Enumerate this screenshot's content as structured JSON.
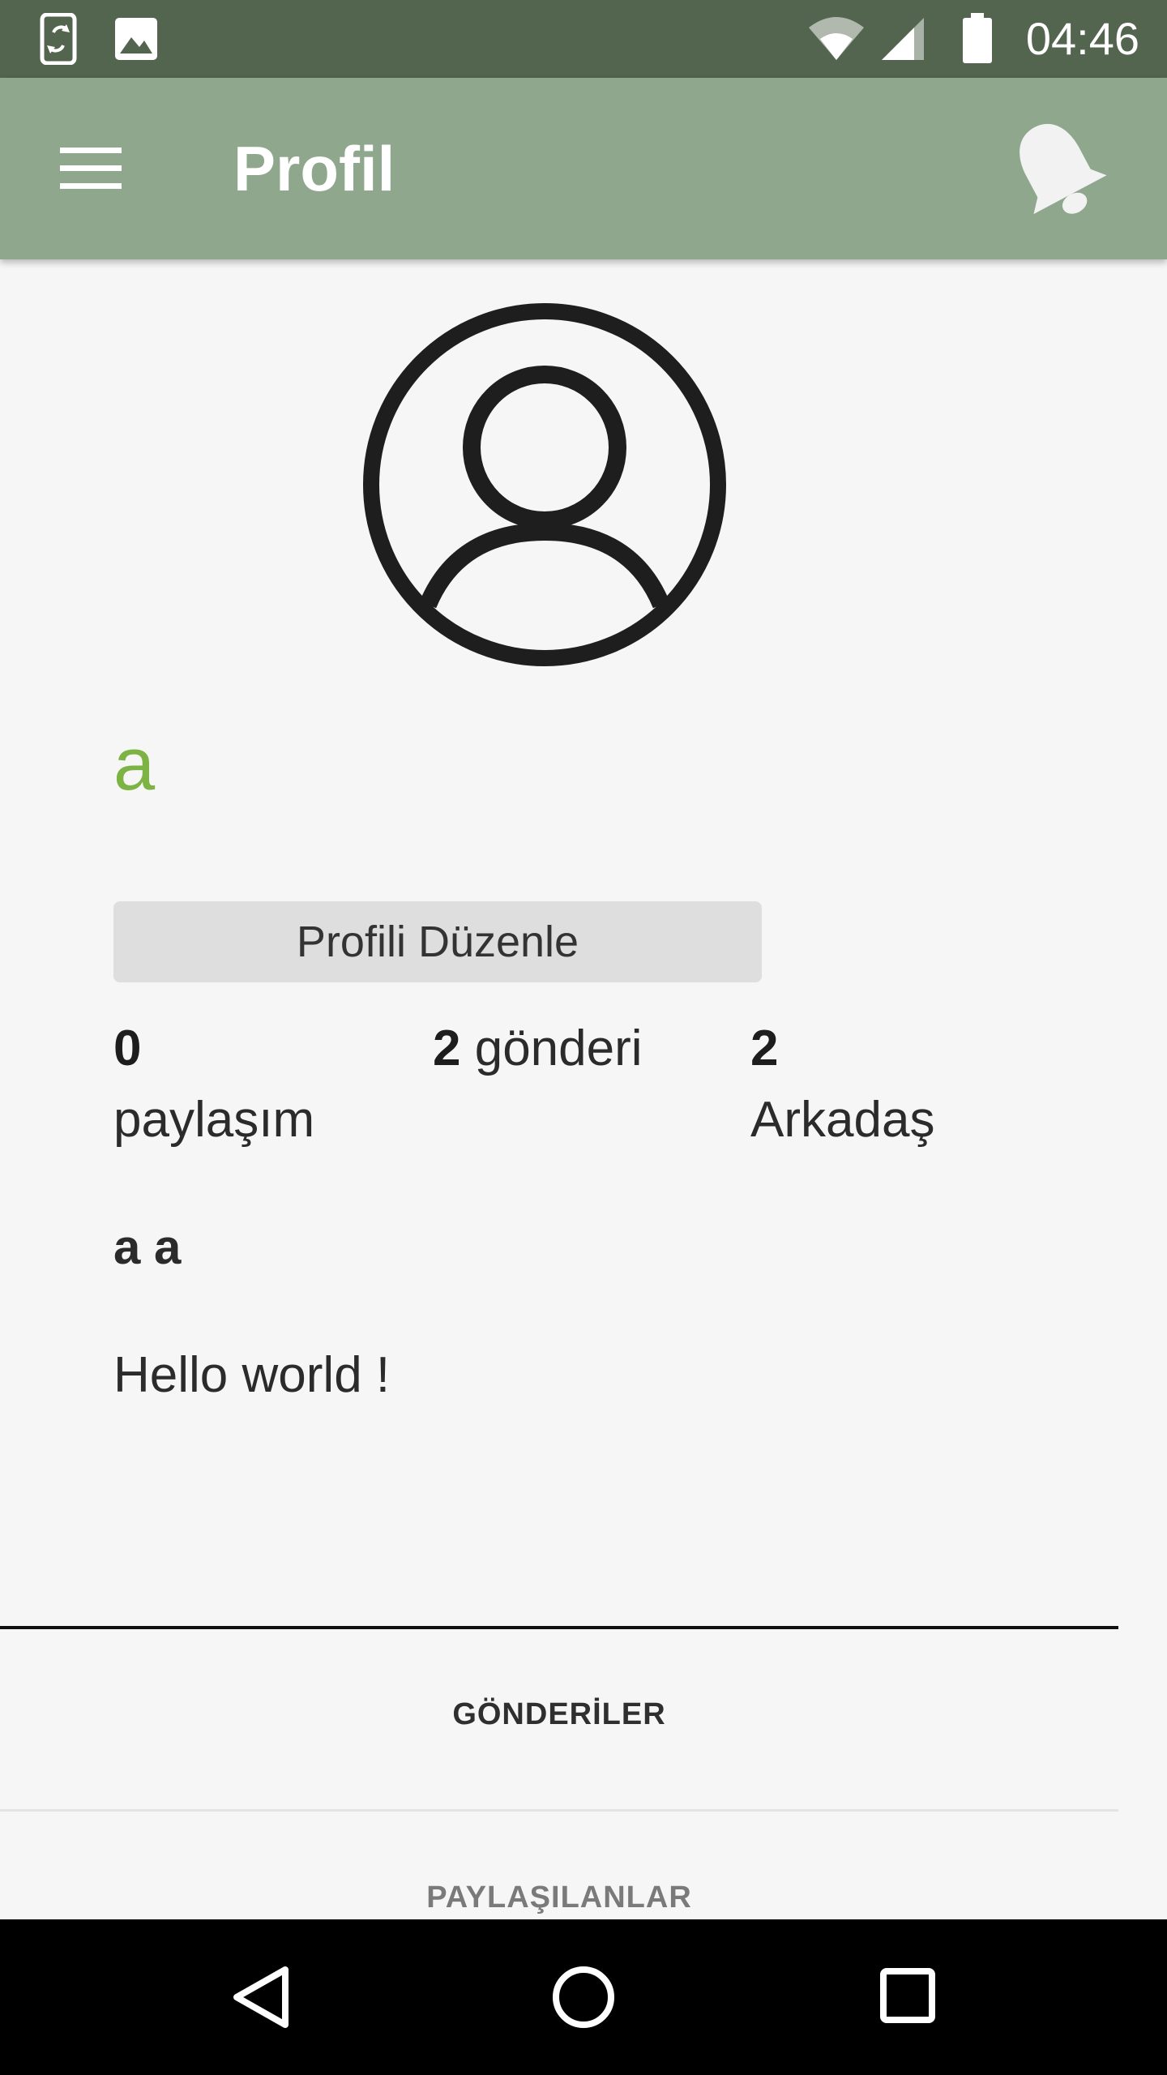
{
  "status_bar": {
    "time": "04:46",
    "icons": [
      "sync-phone-icon",
      "image-icon",
      "wifi-icon",
      "signal-icon",
      "battery-icon"
    ]
  },
  "app_bar": {
    "title": "Profil",
    "menu_icon": "hamburger-menu-icon",
    "notification_icon": "bell-icon"
  },
  "profile": {
    "avatar_icon": "account-circle-icon",
    "username": "a",
    "edit_button_label": "Profili Düzenle",
    "stats": {
      "shares": {
        "count": "0",
        "label": "paylaşım"
      },
      "posts": {
        "count": "2",
        "label": "gönderi"
      },
      "friends": {
        "count": "2",
        "label": "Arkadaş"
      }
    },
    "full_name": "a a",
    "bio": "Hello world !"
  },
  "tabs": [
    {
      "label": "GÖNDERİLER"
    },
    {
      "label": "PAYLAŞILANLAR"
    }
  ],
  "colors": {
    "status_bar": "#53654e",
    "app_bar": "#8fa78d",
    "username": "#7cb342",
    "background": "#f6f6f6"
  },
  "nav_bar": {
    "icons": [
      "back-icon",
      "home-icon",
      "recents-icon"
    ]
  }
}
